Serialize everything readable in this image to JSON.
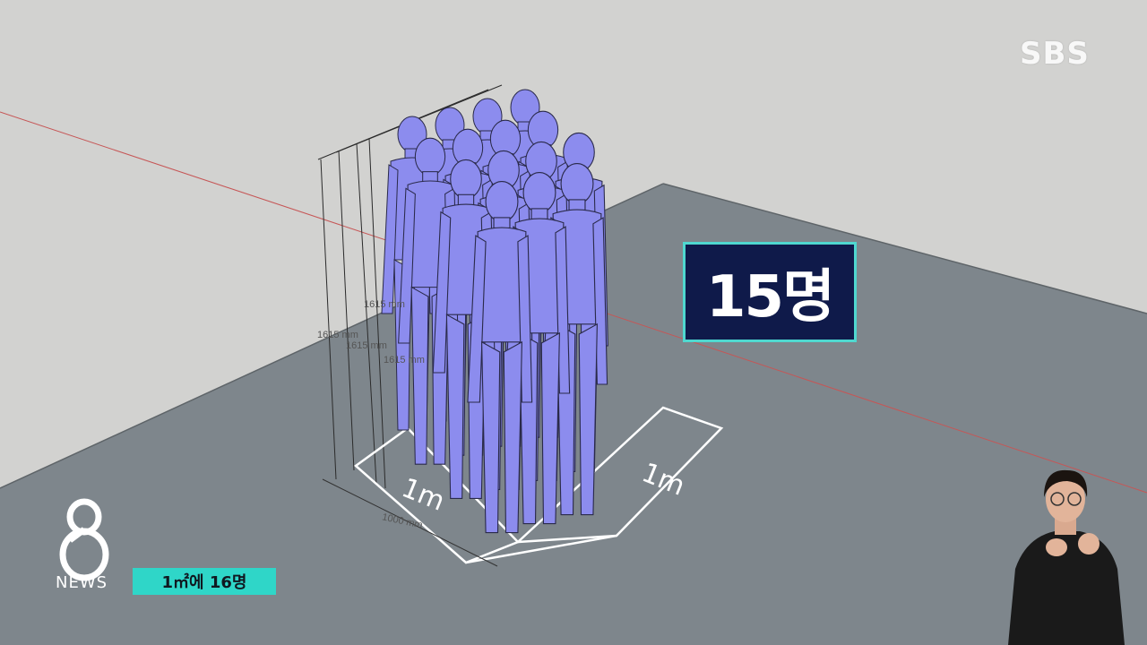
{
  "broadcaster": {
    "logo_text": "SBS"
  },
  "overlay": {
    "count_label": "15명"
  },
  "dimensions": {
    "side_a": "1m",
    "side_b": "1m",
    "base_mm": "1000 mm",
    "height_labels": [
      "1615 mm",
      "1615 mm",
      "1615 mm",
      "1615 mm"
    ]
  },
  "news_logo": {
    "numeral": "8",
    "label": "NEWS"
  },
  "caption": {
    "text": "1㎡에 16명"
  },
  "colors": {
    "figure": "#8c8cee",
    "count_box_bg": "#0f1a4a",
    "count_box_border": "#4fd8d0",
    "caption_bg": "#2fd6c8",
    "floor": "#7e868c",
    "wall": "#d2d2d0"
  }
}
